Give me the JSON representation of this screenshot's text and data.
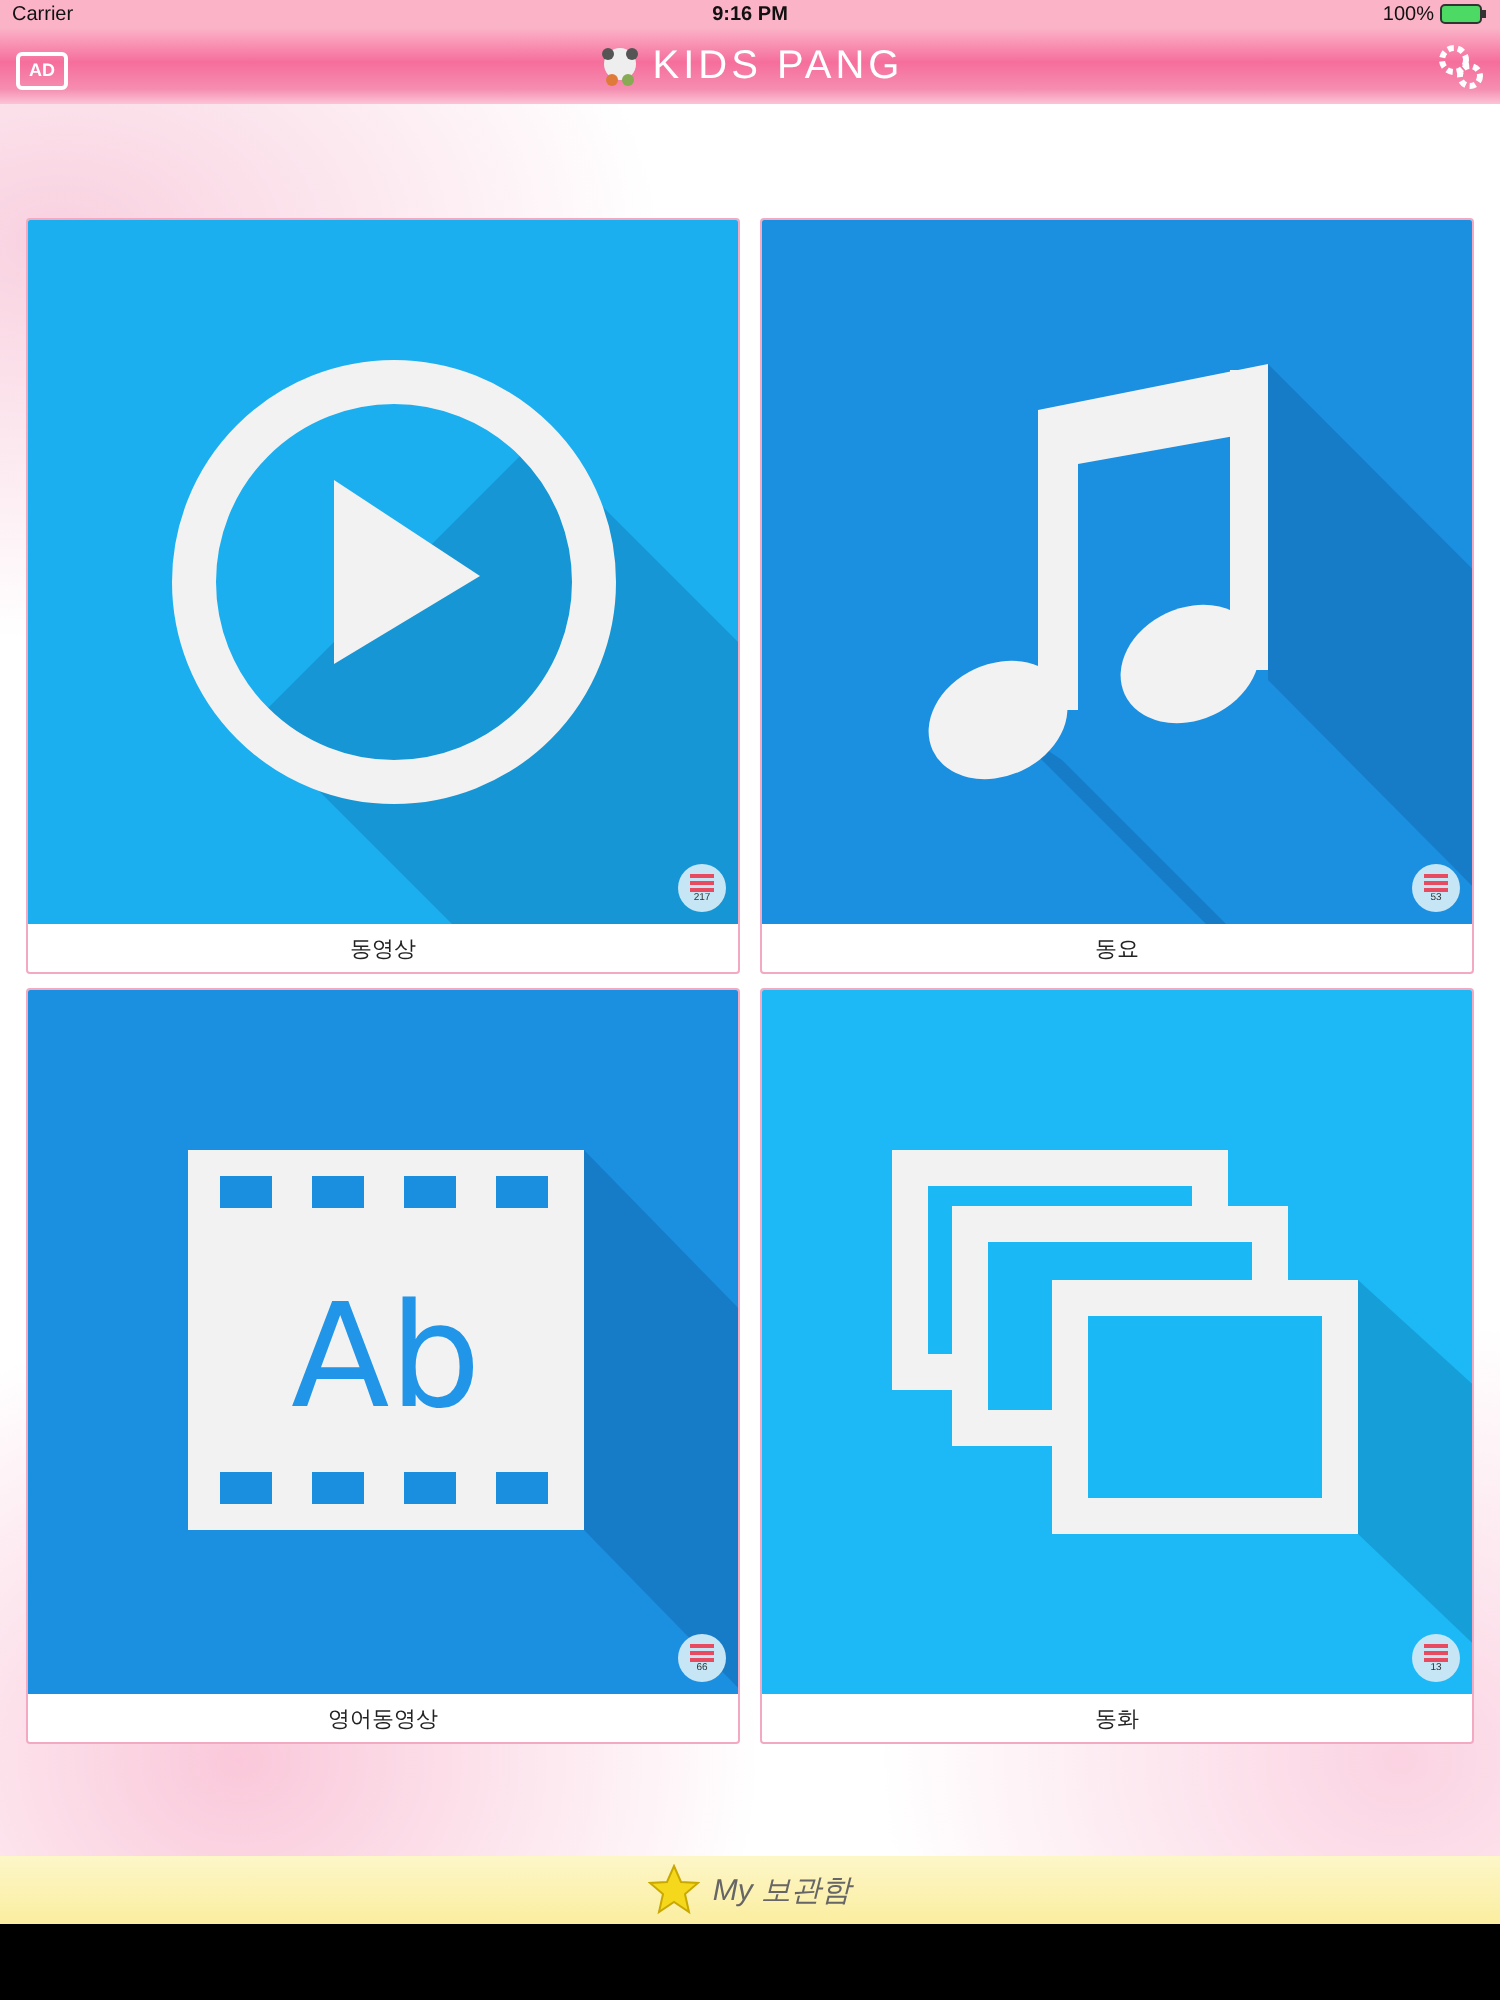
{
  "status_bar": {
    "carrier": "Carrier",
    "time": "9:16 PM",
    "battery": "100%"
  },
  "nav_bar": {
    "ad_label": "AD",
    "title": "KIDS PANG"
  },
  "tiles": [
    {
      "kind": "play",
      "label": "동영상",
      "count": "217"
    },
    {
      "kind": "note",
      "label": "동요",
      "count": "53"
    },
    {
      "kind": "film",
      "label": "영어동영상",
      "count": "66",
      "icon_text": "Ab"
    },
    {
      "kind": "slides",
      "label": "동화",
      "count": "13"
    }
  ],
  "bottom_bar": {
    "label": "My 보관함"
  }
}
